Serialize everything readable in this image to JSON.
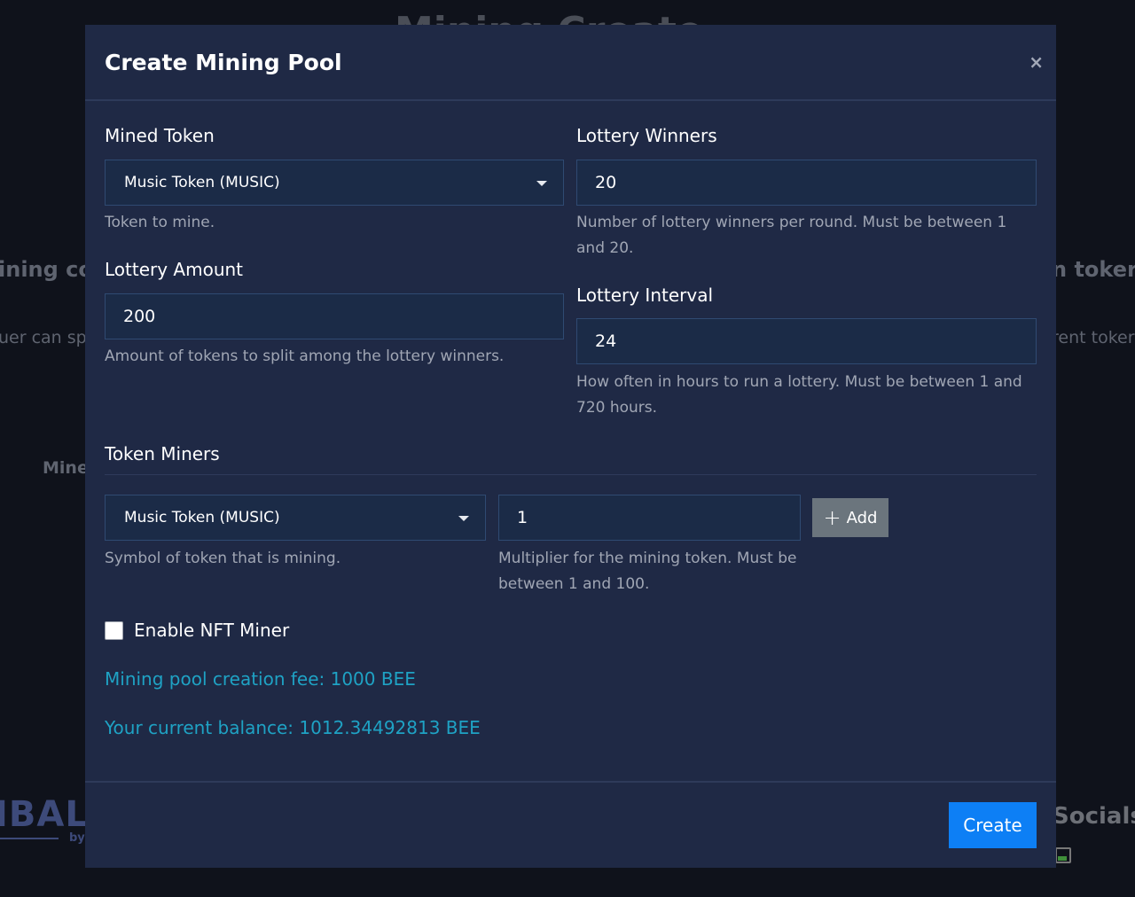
{
  "background": {
    "page_title_fragment": "Mining Create",
    "left_heading_fragment": "ining co",
    "left_paragraph_fragment": "uer can sp",
    "left_mine_fragment": "Mine",
    "right_heading_fragment": "n toker",
    "right_paragraph_fragment": "rent toker",
    "logo_fragment": "IBALI",
    "logo_by": "by",
    "socials_heading": "Socials"
  },
  "modal": {
    "title": "Create Mining Pool",
    "close_icon": "×",
    "mined_token": {
      "label": "Mined Token",
      "selected": "Music Token (MUSIC)",
      "help": "Token to mine."
    },
    "lottery_winners": {
      "label": "Lottery Winners",
      "value": "20",
      "help": "Number of lottery winners per round. Must be between 1 and 20."
    },
    "lottery_amount": {
      "label": "Lottery Amount",
      "value": "200",
      "help": "Amount of tokens to split among the lottery winners."
    },
    "lottery_interval": {
      "label": "Lottery Interval",
      "value": "24",
      "help": "How often in hours to run a lottery. Must be between 1 and 720 hours."
    },
    "token_miners": {
      "section_title": "Token Miners",
      "token_selected": "Music Token (MUSIC)",
      "token_help": "Symbol of token that is mining.",
      "multiplier_value": "1",
      "multiplier_help": "Multiplier for the mining token. Must be between 1 and 100.",
      "add_icon": "+",
      "add_label": "Add"
    },
    "nft_miner": {
      "label": "Enable NFT Miner",
      "checked": false
    },
    "fee_text": "Mining pool creation fee: 1000 BEE",
    "balance_text": "Your current balance: 1012.34492813 BEE",
    "create_label": "Create"
  },
  "colors": {
    "modal_bg": "#1f2945",
    "input_bg": "#1b2b47",
    "accent_info": "#1fa2c4",
    "primary_button": "#0d7ff5",
    "secondary_button": "#6b757d"
  }
}
